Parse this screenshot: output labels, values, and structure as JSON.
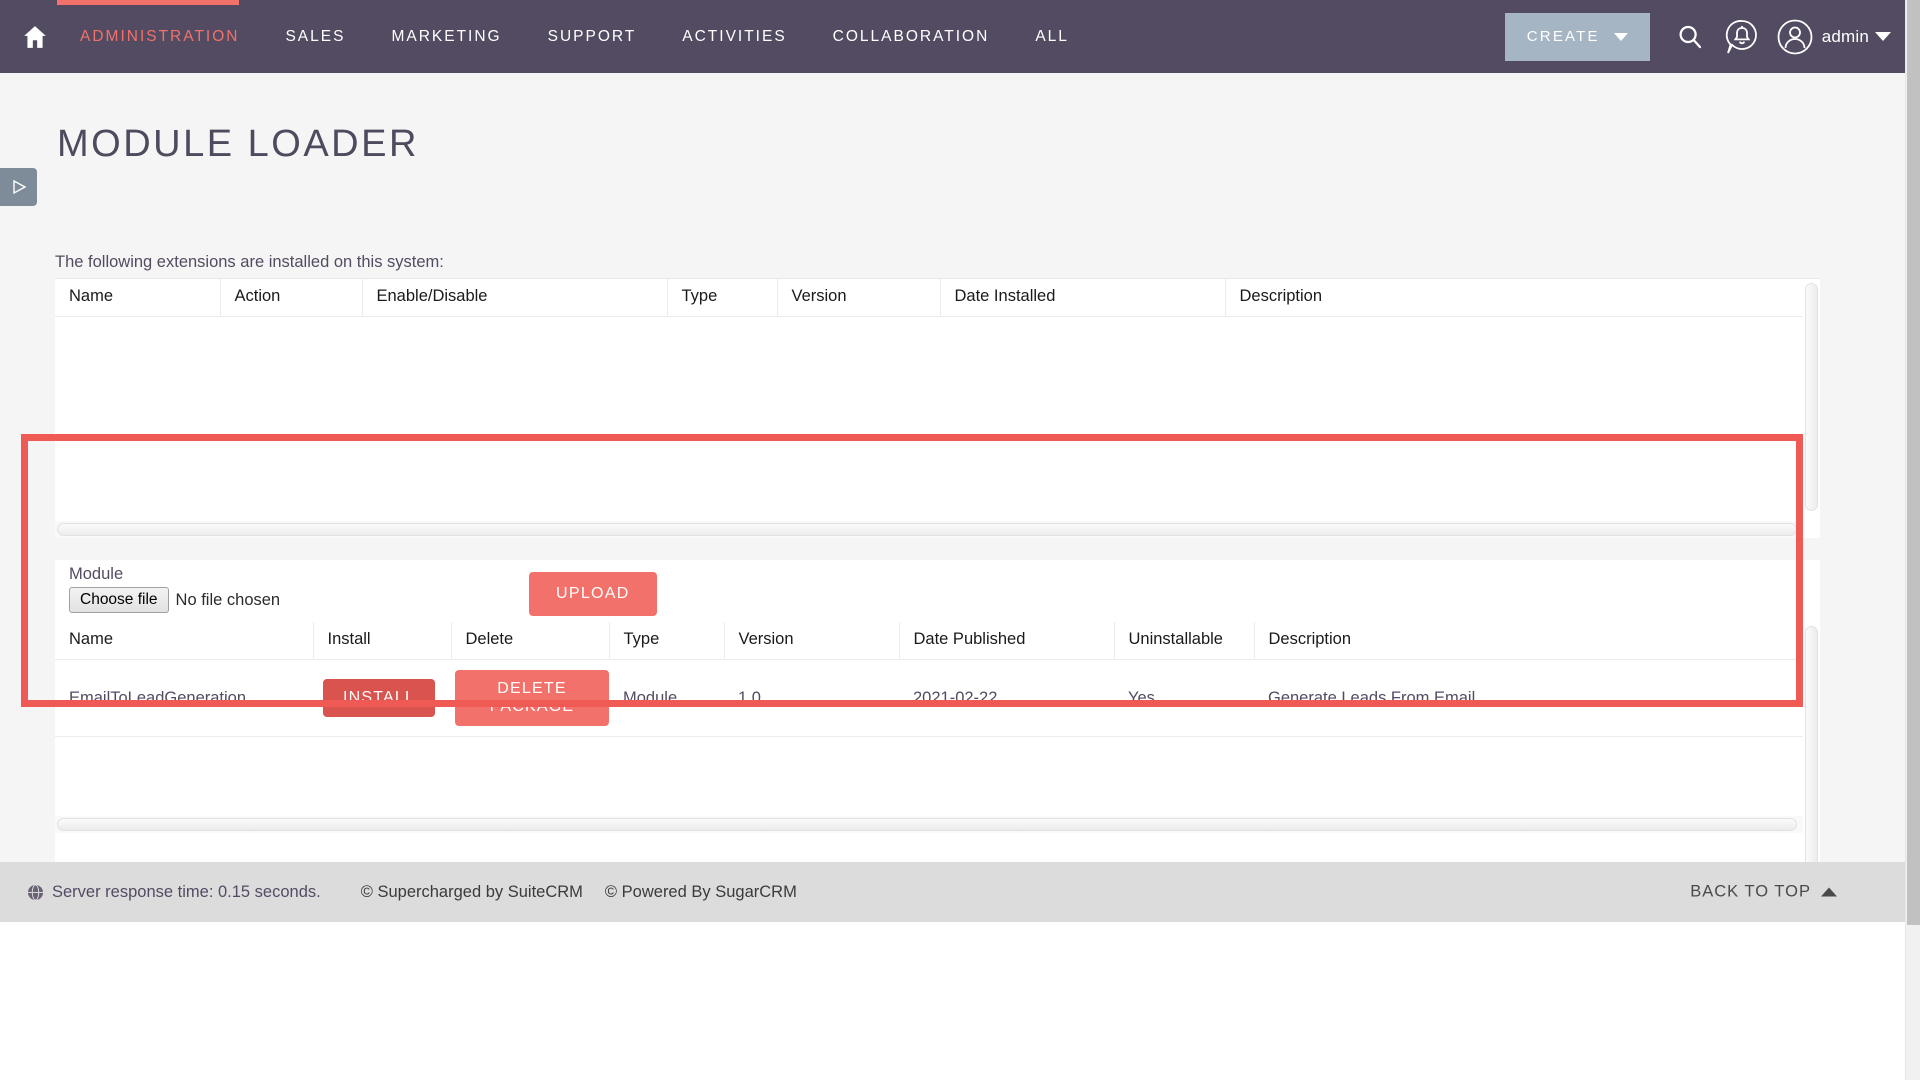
{
  "navbar": {
    "home_icon": "home-icon",
    "items": [
      {
        "label": "ADMINISTRATION",
        "active": true
      },
      {
        "label": "SALES",
        "active": false
      },
      {
        "label": "MARKETING",
        "active": false
      },
      {
        "label": "SUPPORT",
        "active": false
      },
      {
        "label": "ACTIVITIES",
        "active": false
      },
      {
        "label": "COLLABORATION",
        "active": false
      },
      {
        "label": "ALL",
        "active": false
      }
    ],
    "create_label": "CREATE",
    "search_icon": "search-icon",
    "notifications_icon": "notification-bell-icon",
    "avatar_icon": "user-avatar-icon",
    "user_label": "admin",
    "accent_color": "#f3716b",
    "bar_color": "#534b61",
    "create_button_color": "#a6b5c4"
  },
  "page": {
    "title": "MODULE LOADER",
    "subtitle": "The following extensions are installed on this system:"
  },
  "installed_table": {
    "headers": [
      "Name",
      "Action",
      "Enable/Disable",
      "Type",
      "Version",
      "Date Installed",
      "Description"
    ],
    "rows": []
  },
  "upload": {
    "module_label": "Module",
    "choose_file_label": "Choose file",
    "no_file_text": "No file chosen",
    "upload_label": "UPLOAD"
  },
  "packages_table": {
    "headers": [
      "Name",
      "Install",
      "Delete",
      "Type",
      "Version",
      "Date Published",
      "Uninstallable",
      "Description"
    ],
    "rows": [
      {
        "name": "EmailToLeadGeneration",
        "install_label": "INSTALL",
        "delete_label": "DELETE PACKAGE",
        "type": "Module",
        "version": "1.0",
        "date_published": "2021-02-22",
        "uninstallable": "Yes",
        "description": "Generate Leads From Email"
      }
    ]
  },
  "footer": {
    "globe_icon": "globe-icon",
    "server_response": "Server response time: 0.15 seconds.",
    "supercharged": "© Supercharged by SuiteCRM",
    "powered": "© Powered By SugarCRM",
    "back_to_top": "BACK TO TOP"
  },
  "annotation": {
    "color": "#f05a54"
  }
}
